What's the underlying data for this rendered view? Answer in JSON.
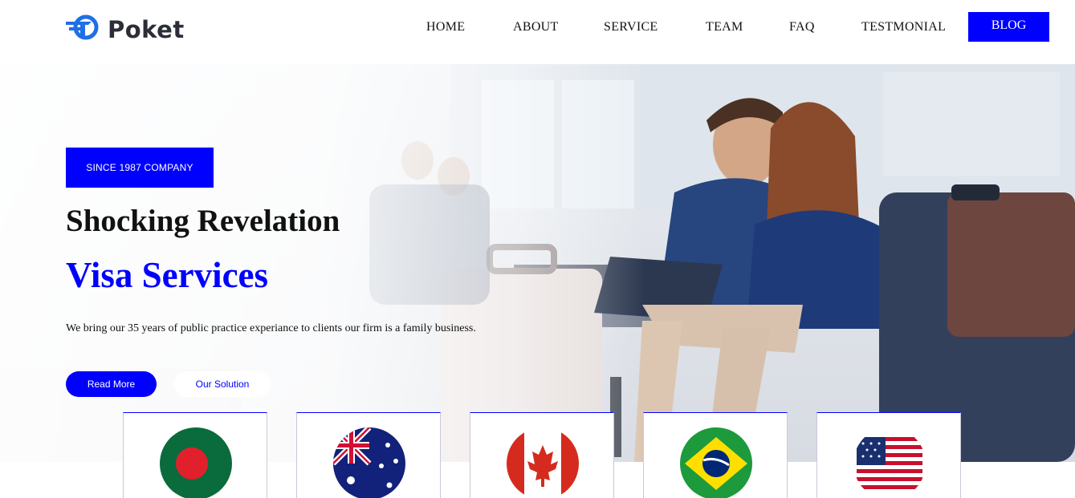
{
  "brand": {
    "name": "Poket",
    "logo_icon": "logo-arrow-icon",
    "color": "#0000ff"
  },
  "nav": {
    "items": [
      {
        "label": "HOME"
      },
      {
        "label": "ABOUT"
      },
      {
        "label": "SERVICE"
      },
      {
        "label": "TEAM"
      },
      {
        "label": "FAQ"
      },
      {
        "label": "TESTMONIAL"
      }
    ],
    "cta": "BLOG"
  },
  "hero": {
    "badge": "SINCE 1987 COMPANY",
    "title_line1": "Shocking Revelation",
    "title_line2": "Visa Services",
    "description": "We bring our 35 years of public practice experiance to clients our firm is a family business.",
    "primary_button": "Read More",
    "secondary_button": "Our Solution"
  },
  "countries": [
    {
      "flag": "bangladesh-flag-icon"
    },
    {
      "flag": "australia-flag-icon"
    },
    {
      "flag": "canada-flag-icon"
    },
    {
      "flag": "brazil-flag-icon"
    },
    {
      "flag": "usa-flag-icon"
    }
  ],
  "colors": {
    "accent": "#0000ff",
    "text": "#111111"
  }
}
